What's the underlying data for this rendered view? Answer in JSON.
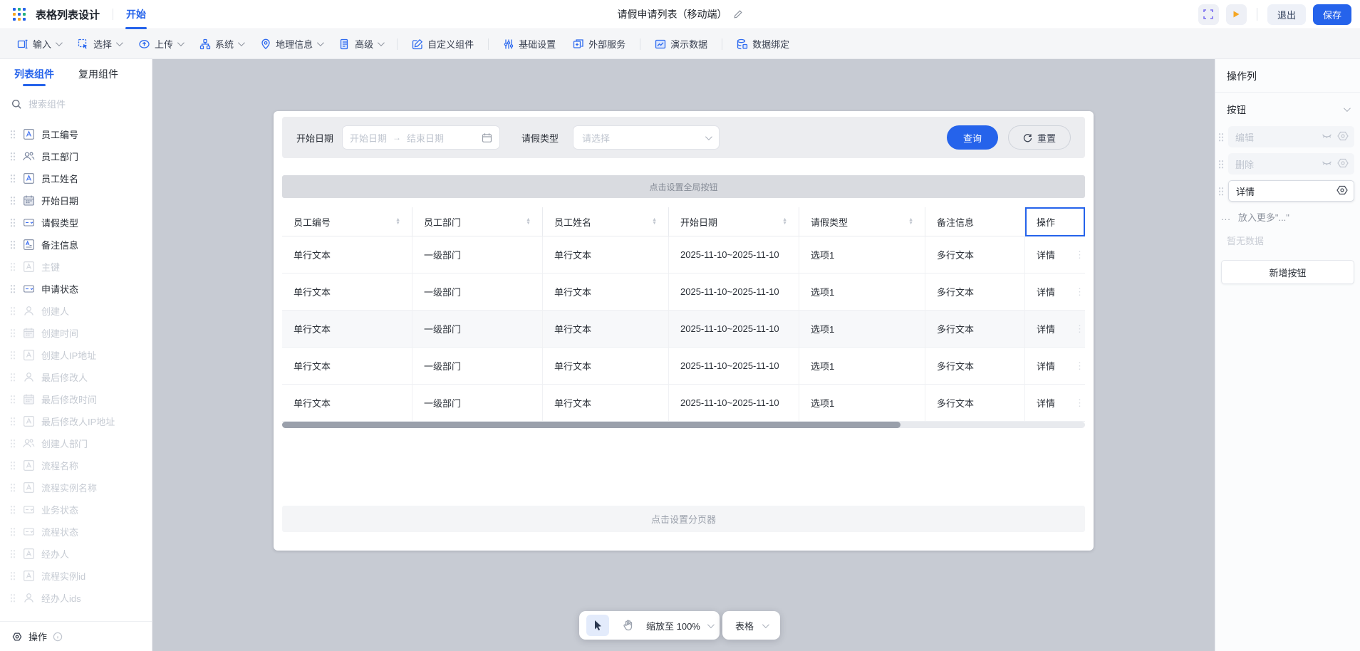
{
  "header": {
    "app_title": "表格列表设计",
    "nav_start": "开始",
    "page_title": "请假申请列表（移动端）",
    "exit_label": "退出",
    "save_label": "保存"
  },
  "toolbar": {
    "items": [
      {
        "label": "输入",
        "icon": "input-icon",
        "chevron": true,
        "divider_after": false
      },
      {
        "label": "选择",
        "icon": "select-icon",
        "chevron": true,
        "divider_after": false
      },
      {
        "label": "上传",
        "icon": "upload-icon",
        "chevron": true,
        "divider_after": false
      },
      {
        "label": "系统",
        "icon": "system-icon",
        "chevron": true,
        "divider_after": false
      },
      {
        "label": "地理信息",
        "icon": "geo-icon",
        "chevron": true,
        "divider_after": false
      },
      {
        "label": "高级",
        "icon": "advanced-icon",
        "chevron": true,
        "divider_after": true
      },
      {
        "label": "自定义组件",
        "icon": "custom-component-icon",
        "chevron": false,
        "divider_after": true
      },
      {
        "label": "基础设置",
        "icon": "settings-icon",
        "chevron": false,
        "divider_after": false
      },
      {
        "label": "外部服务",
        "icon": "external-service-icon",
        "chevron": false,
        "divider_after": true
      },
      {
        "label": "演示数据",
        "icon": "demo-data-icon",
        "chevron": false,
        "divider_after": true
      },
      {
        "label": "数据绑定",
        "icon": "data-binding-icon",
        "chevron": false,
        "divider_after": false
      }
    ]
  },
  "sidebar": {
    "tabs": [
      {
        "label": "列表组件",
        "active": true
      },
      {
        "label": "复用组件",
        "active": false
      }
    ],
    "search_placeholder": "搜索组件",
    "items": [
      {
        "label": "员工编号",
        "icon": "text-field-icon",
        "disabled": false
      },
      {
        "label": "员工部门",
        "icon": "department-icon",
        "disabled": false
      },
      {
        "label": "员工姓名",
        "icon": "text-field-icon",
        "disabled": false
      },
      {
        "label": "开始日期",
        "icon": "date-field-icon",
        "disabled": false
      },
      {
        "label": "请假类型",
        "icon": "select-field-icon",
        "disabled": false
      },
      {
        "label": "备注信息",
        "icon": "textarea-field-icon",
        "disabled": false
      },
      {
        "label": "主键",
        "icon": "text-field-icon",
        "disabled": true
      },
      {
        "label": "申请状态",
        "icon": "select-field-icon",
        "disabled": false
      },
      {
        "label": "创建人",
        "icon": "person-icon",
        "disabled": true
      },
      {
        "label": "创建时间",
        "icon": "date-field-icon",
        "disabled": true
      },
      {
        "label": "创建人IP地址",
        "icon": "text-field-icon",
        "disabled": true
      },
      {
        "label": "最后修改人",
        "icon": "person-icon",
        "disabled": true
      },
      {
        "label": "最后修改时间",
        "icon": "date-field-icon",
        "disabled": true
      },
      {
        "label": "最后修改人IP地址",
        "icon": "text-field-icon",
        "disabled": true
      },
      {
        "label": "创建人部门",
        "icon": "department-icon",
        "disabled": true
      },
      {
        "label": "流程名称",
        "icon": "text-field-icon",
        "disabled": true
      },
      {
        "label": "流程实例名称",
        "icon": "text-field-icon",
        "disabled": true
      },
      {
        "label": "业务状态",
        "icon": "select-field-icon",
        "disabled": true
      },
      {
        "label": "流程状态",
        "icon": "select-field-icon",
        "disabled": true
      },
      {
        "label": "经办人",
        "icon": "text-field-icon",
        "disabled": true
      },
      {
        "label": "流程实例id",
        "icon": "text-field-icon",
        "disabled": true
      },
      {
        "label": "经办人ids",
        "icon": "person-icon",
        "disabled": true
      }
    ],
    "footer_label": "操作"
  },
  "canvas": {
    "filter": {
      "date_label": "开始日期",
      "date_start_placeholder": "开始日期",
      "date_end_placeholder": "结束日期",
      "range_arrow": "→",
      "type_label": "请假类型",
      "type_placeholder": "请选择",
      "query_label": "查询",
      "reset_label": "重置"
    },
    "global_button_bar": "点击设置全局按钮",
    "table": {
      "columns": [
        {
          "label": "员工编号",
          "sortable": true,
          "selected": false
        },
        {
          "label": "员工部门",
          "sortable": true,
          "selected": false
        },
        {
          "label": "员工姓名",
          "sortable": true,
          "selected": false
        },
        {
          "label": "开始日期",
          "sortable": true,
          "selected": false
        },
        {
          "label": "请假类型",
          "sortable": true,
          "selected": false
        },
        {
          "label": "备注信息",
          "sortable": false,
          "selected": false
        },
        {
          "label": "操作",
          "sortable": false,
          "selected": true
        }
      ],
      "rows": [
        {
          "cells": [
            "单行文本",
            "一级部门",
            "单行文本",
            "2025-11-10~2025-11-10",
            "选项1",
            "多行文本",
            "详情"
          ],
          "shaded": false
        },
        {
          "cells": [
            "单行文本",
            "一级部门",
            "单行文本",
            "2025-11-10~2025-11-10",
            "选项1",
            "多行文本",
            "详情"
          ],
          "shaded": false
        },
        {
          "cells": [
            "单行文本",
            "一级部门",
            "单行文本",
            "2025-11-10~2025-11-10",
            "选项1",
            "多行文本",
            "详情"
          ],
          "shaded": true
        },
        {
          "cells": [
            "单行文本",
            "一级部门",
            "单行文本",
            "2025-11-10~2025-11-10",
            "选项1",
            "多行文本",
            "详情"
          ],
          "shaded": false
        },
        {
          "cells": [
            "单行文本",
            "一级部门",
            "单行文本",
            "2025-11-10~2025-11-10",
            "选项1",
            "多行文本",
            "详情"
          ],
          "shaded": false
        }
      ]
    },
    "pagination_bar": "点击设置分页器",
    "zoom_control": {
      "zoom_label": "缩放至 100%",
      "component_label": "表格"
    }
  },
  "right_panel": {
    "title": "操作列",
    "section_label": "按钮",
    "buttons": [
      {
        "label": "编辑",
        "hidden": true
      },
      {
        "label": "删除",
        "hidden": true
      },
      {
        "label": "详情",
        "hidden": false
      }
    ],
    "more_label": "放入更多\"...\"",
    "more_ellipsis": "...",
    "empty_label": "暂无数据",
    "add_button_label": "新增按钮"
  },
  "colors": {
    "accent": "#2563eb",
    "canvas_bg": "#c7cbd3",
    "play_icon": "#f5a623",
    "expand_icon": "#7a6ff0"
  }
}
